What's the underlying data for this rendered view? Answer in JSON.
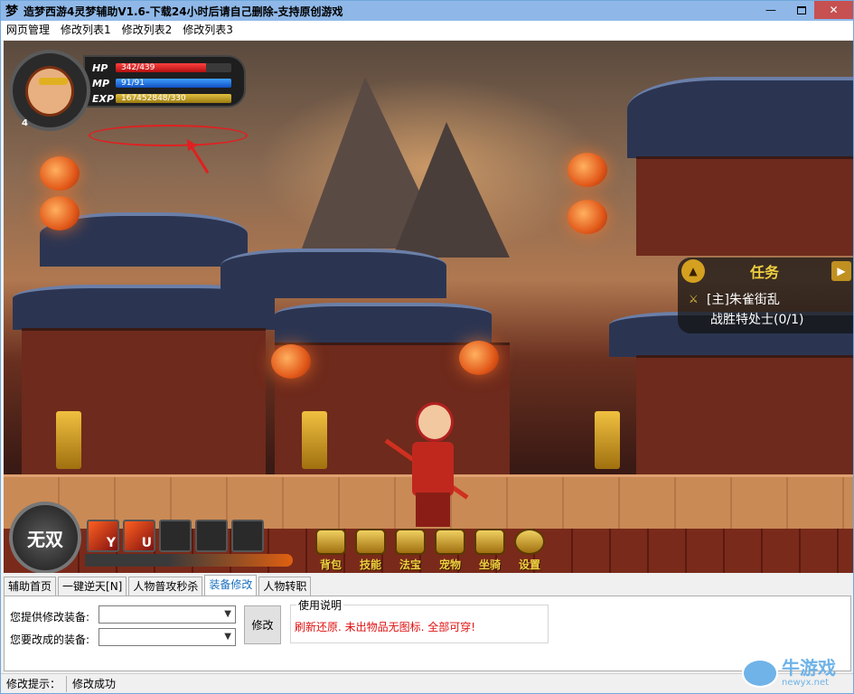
{
  "window": {
    "icon_glyph": "梦",
    "title": "造梦西游4灵梦辅助V1.6-下载24小时后请自己删除-支持原创游戏",
    "minimize_glyph": "—",
    "close_glyph": "✕"
  },
  "menu": {
    "items": [
      "网页管理",
      "修改列表1",
      "修改列表2",
      "修改列表3"
    ]
  },
  "game": {
    "level": "4",
    "hp": {
      "label": "HP",
      "text": "342/439",
      "fraction": 0.78
    },
    "mp": {
      "label": "MP",
      "text": "91/91",
      "fraction": 1.0
    },
    "exp": {
      "label": "EXP",
      "text": "167452848/330",
      "fraction": 1.0
    },
    "quest": {
      "title": "任务",
      "name": "[主]朱雀街乱",
      "progress": "战胜特处士(0/1)"
    },
    "wushuang_label": "无双",
    "skill_keys": [
      "Y",
      "U"
    ],
    "buttons": [
      "背包",
      "技能",
      "法宝",
      "宠物",
      "坐骑",
      "设置"
    ],
    "colors": {
      "hp": "#e02020",
      "mp": "#1a70d0",
      "quest_title": "#f0d040",
      "annotation": "#e02020"
    }
  },
  "tabs": {
    "items": [
      "辅助首页",
      "一键逆天[N]",
      "人物普攻秒杀",
      "装备修改",
      "人物转职"
    ],
    "active_index": 3
  },
  "equip": {
    "provide_label": "您提供修改装备:",
    "provide_value": "",
    "target_label": "您要改成的装备:",
    "target_value": "",
    "modify_button": "修改",
    "usage_title": "使用说明",
    "usage_text": "刷新还原. 未出物品无图标. 全部可穿!"
  },
  "status": {
    "label": "修改提示：",
    "value": "修改成功"
  },
  "watermark": {
    "big": "牛游戏",
    "small": "newyx.net"
  }
}
